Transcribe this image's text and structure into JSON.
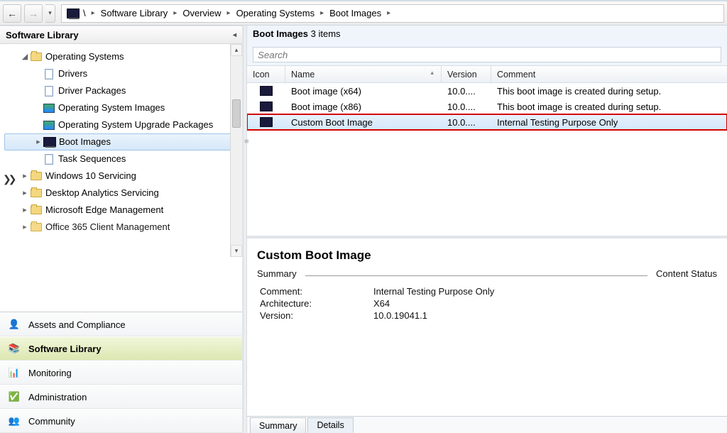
{
  "breadcrumb": {
    "root": "\\",
    "items": [
      "Software Library",
      "Overview",
      "Operating Systems",
      "Boot Images"
    ]
  },
  "left_panel": {
    "title": "Software Library"
  },
  "tree": {
    "os_root": "Operating Systems",
    "items": [
      "Drivers",
      "Driver Packages",
      "Operating System Images",
      "Operating System Upgrade Packages",
      "Boot Images",
      "Task Sequences"
    ],
    "extra": [
      "Windows 10 Servicing",
      "Desktop Analytics Servicing",
      "Microsoft Edge Management",
      "Office 365 Client Management"
    ]
  },
  "wunderbar": {
    "items": [
      "Assets and Compliance",
      "Software Library",
      "Monitoring",
      "Administration",
      "Community"
    ],
    "selected": 1
  },
  "list": {
    "title": "Boot Images",
    "count_label": "3 items",
    "search_placeholder": "Search",
    "columns": {
      "icon": "Icon",
      "name": "Name",
      "version": "Version",
      "comment": "Comment"
    },
    "rows": [
      {
        "name": "Boot image (x64)",
        "version": "10.0....",
        "comment": "This boot image is created during setup."
      },
      {
        "name": "Boot image (x86)",
        "version": "10.0....",
        "comment": "This boot image is created during setup."
      },
      {
        "name": "Custom Boot Image",
        "version": "10.0....",
        "comment": "Internal Testing Purpose Only"
      }
    ],
    "highlighted_row": 2
  },
  "detail": {
    "title": "Custom Boot Image",
    "section_left": "Summary",
    "section_right": "Content Status",
    "fields": {
      "Comment:": "Internal Testing Purpose Only",
      "Architecture:": "X64",
      "Version:": "10.0.19041.1"
    },
    "tabs": {
      "summary": "Summary",
      "details": "Details",
      "selected": "details"
    }
  }
}
